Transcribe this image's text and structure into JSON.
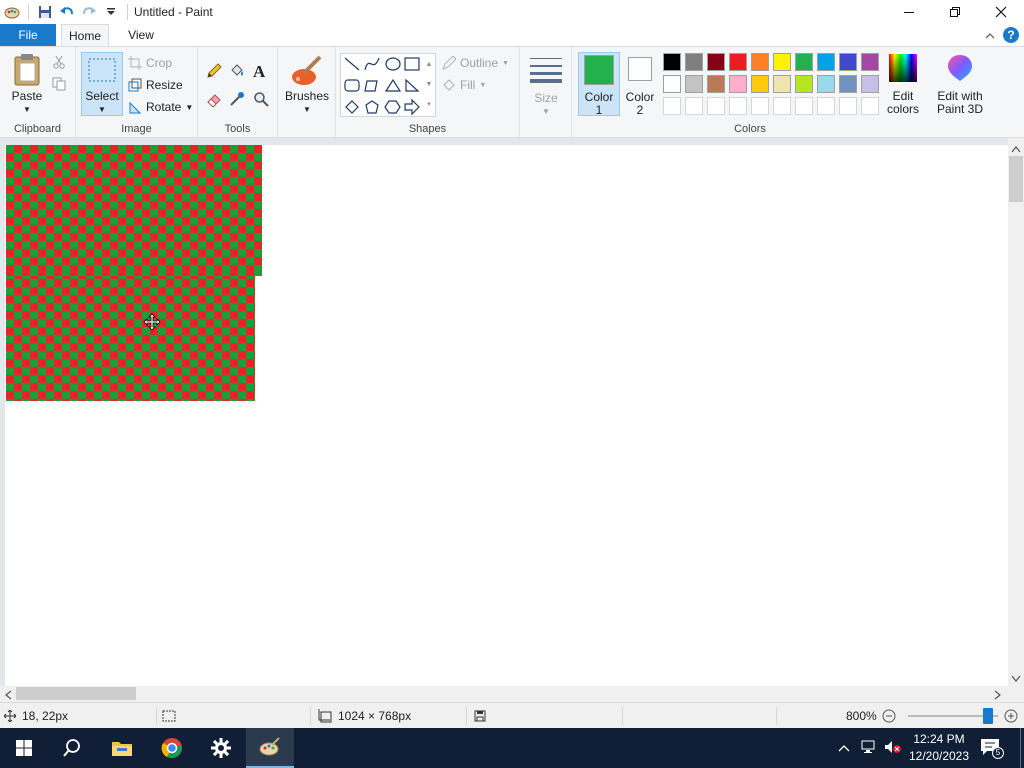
{
  "window": {
    "title": "Untitled - Paint"
  },
  "tabs": {
    "file": "File",
    "home": "Home",
    "view": "View"
  },
  "ribbon": {
    "clipboard": {
      "paste": "Paste",
      "label": "Clipboard"
    },
    "image": {
      "select": "Select",
      "crop": "Crop",
      "resize": "Resize",
      "rotate": "Rotate",
      "label": "Image"
    },
    "tools": {
      "label": "Tools"
    },
    "brushes": {
      "label": "Brushes"
    },
    "shapes": {
      "outline": "Outline",
      "fill": "Fill",
      "label": "Shapes"
    },
    "size": {
      "label": "Size"
    },
    "color1": {
      "label1": "Color",
      "label2": "1",
      "value": "#22b14c"
    },
    "color2": {
      "label1": "Color",
      "label2": "2",
      "value": "#ffffff"
    },
    "colors": {
      "label": "Colors",
      "row1": [
        "#000000",
        "#7f7f7f",
        "#880015",
        "#ed1c24",
        "#ff7f27",
        "#fff200",
        "#22b14c",
        "#00a2e8",
        "#3f48cc",
        "#a349a4"
      ],
      "row2": [
        "#ffffff",
        "#c3c3c3",
        "#b97a57",
        "#ffaec9",
        "#ffc90e",
        "#efe4b0",
        "#b5e61d",
        "#99d9ea",
        "#7092be",
        "#c8bfe7"
      ]
    },
    "edit_colors": {
      "line1": "Edit",
      "line2": "colors"
    },
    "paint3d": {
      "line1": "Edit with",
      "line2": "Paint 3D"
    }
  },
  "canvas": {
    "pattern_colors": [
      "#e52428",
      "#1e9e3a"
    ]
  },
  "status": {
    "cursor_pos": "18, 22px",
    "canvas_size": "1024 × 768px",
    "zoom": "800%"
  },
  "taskbar": {
    "time": "12:24 PM",
    "date": "12/20/2023",
    "notifications": "5"
  }
}
